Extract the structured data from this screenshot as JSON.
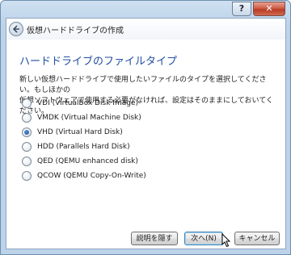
{
  "window": {
    "help_label": "?",
    "close_label": "✕"
  },
  "header": {
    "title": "仮想ハードドライブの作成"
  },
  "page": {
    "section_title": "ハードドライブのファイルタイプ",
    "description_line1": "新しい仮想ハードドライブで使用したいファイルのタイプを選択してください。もしほかの",
    "description_line2": "仮想ソフトウェアで使用する必要がなければ、設定はそのままにしておいてください。"
  },
  "options": [
    {
      "label": "VDI (VirtualBox Disk Image)",
      "selected": false
    },
    {
      "label": "VMDK (Virtual Machine Disk)",
      "selected": false
    },
    {
      "label": "VHD (Virtual Hard Disk)",
      "selected": true
    },
    {
      "label": "HDD (Parallels Hard Disk)",
      "selected": false
    },
    {
      "label": "QED (QEMU enhanced disk)",
      "selected": false
    },
    {
      "label": "QCOW (QEMU Copy-On-Write)",
      "selected": false
    }
  ],
  "buttons": {
    "hide_description": "説明を隠す",
    "next": "次へ(N)",
    "cancel": "キャンセル"
  }
}
